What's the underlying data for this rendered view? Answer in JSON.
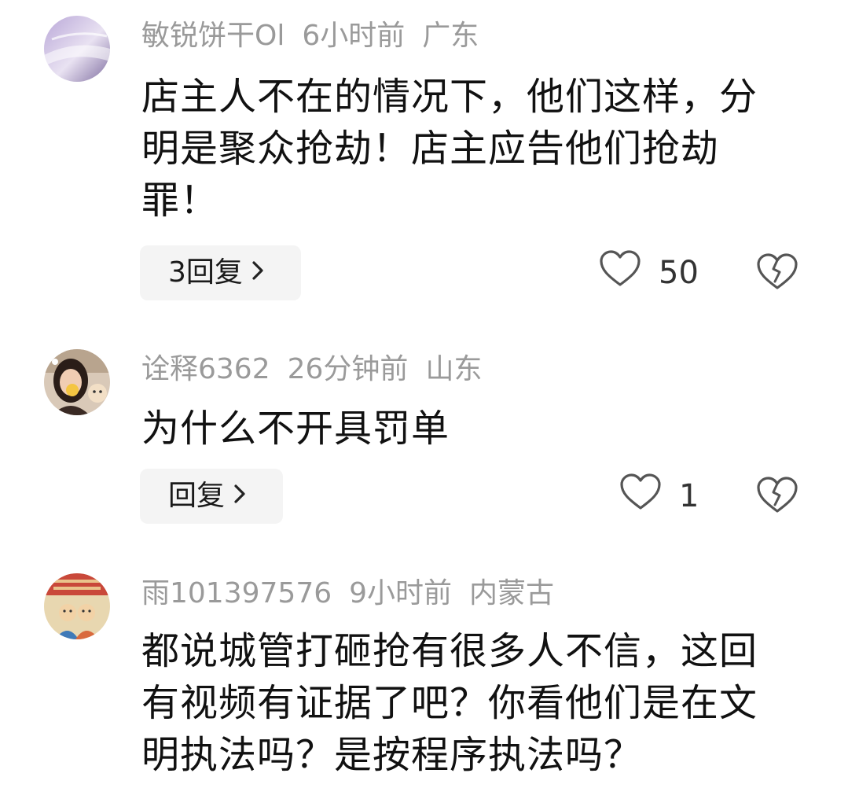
{
  "comments": [
    {
      "username": "敏锐饼干Ol",
      "time": "6小时前",
      "location": "广东",
      "text": "店主人不在的情况下，他们这样，分明是聚众抢劫！店主应告他们抢劫罪！",
      "reply_label": "3回复",
      "likes": "50"
    },
    {
      "username": "诠释6362",
      "time": "26分钟前",
      "location": "山东",
      "text": "为什么不开具罚单",
      "reply_label": "回复",
      "likes": "1"
    },
    {
      "username": "雨101397576",
      "time": "9小时前",
      "location": "内蒙古",
      "text": "都说城管打砸抢有很多人不信，这回有视频有证据了吧？你看他们是在文明执法吗？是按程序执法吗？"
    }
  ],
  "icons": {
    "like": "heart-outline-icon",
    "dislike": "broken-heart-icon",
    "chevron": "chevron-right-icon"
  },
  "colors": {
    "meta_text": "#9a9a9a",
    "reply_bg": "#f4f4f4",
    "icon_stroke": "#555555"
  }
}
